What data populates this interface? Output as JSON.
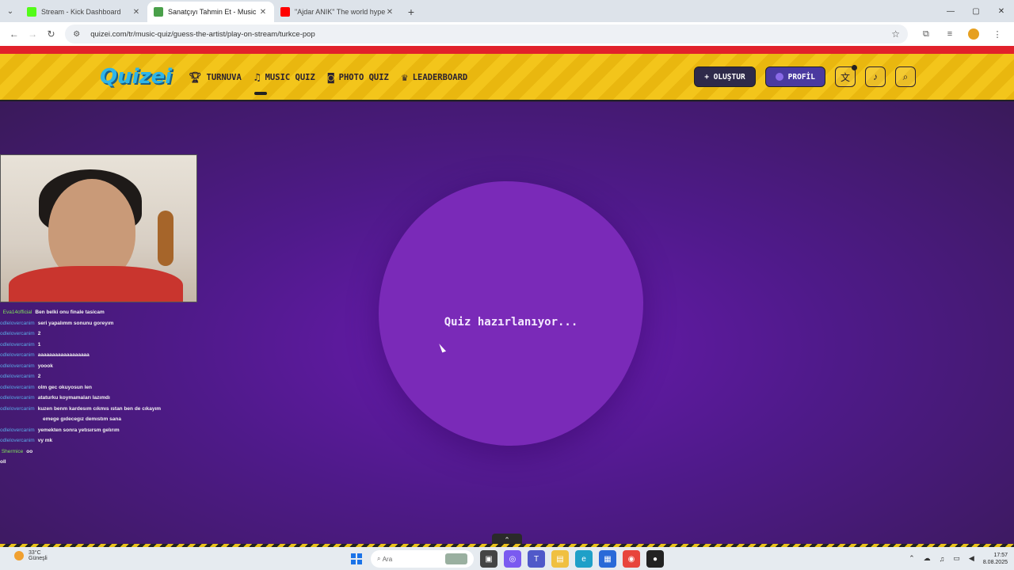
{
  "browser": {
    "tabs": [
      {
        "title": "Stream - Kick Dashboard",
        "favicon_color": "#53fc18",
        "active": false
      },
      {
        "title": "Sanatçıyı Tahmin Et - Music Qu",
        "favicon_color": "#4aa04a",
        "active": true
      },
      {
        "title": "\"Ajdar ANIK\" The world hyper",
        "favicon_color": "#ff0000",
        "active": false
      }
    ],
    "new_tab": "+",
    "url": "quizei.com/tr/music-quiz/guess-the-artist/play-on-stream/turkce-pop"
  },
  "site": {
    "logo": "Quizei",
    "nav": [
      {
        "label": "TURNUVA",
        "icon": "trophy-icon",
        "glyph": "🏆︎"
      },
      {
        "label": "MUSIC QUIZ",
        "icon": "music-note-icon",
        "glyph": "♫",
        "active": true
      },
      {
        "label": "PHOTO QUIZ",
        "icon": "camera-icon",
        "glyph": "◙"
      },
      {
        "label": "LEADERBOARD",
        "icon": "award-icon",
        "glyph": "♛"
      }
    ],
    "create_label": "+ OLUŞTUR",
    "profile_label": "PROFİL",
    "colors": {
      "nav_yellow": "#f3c51b",
      "red_bar": "#e1212b",
      "purple": "#6a1ab0",
      "logo_blue": "#2fb5e8"
    }
  },
  "main": {
    "loading_text": "Quiz hazırlanıyor..."
  },
  "stream_overlay": {
    "chat": [
      {
        "user": "Eva14official",
        "msg": "Ben belki onu finale tasicam",
        "green": true
      },
      {
        "user": "odlelovercanim",
        "msg": "seri yapalımm sonunu goreyım"
      },
      {
        "user": "odlelovercanim",
        "msg": "2"
      },
      {
        "user": "odlelovercanim",
        "msg": "1"
      },
      {
        "user": "odlelovercanim",
        "msg": "aaaaaaaaaaaaaaaaaa"
      },
      {
        "user": "odlelovercanim",
        "msg": "yoook"
      },
      {
        "user": "odlelovercanim",
        "msg": "2"
      },
      {
        "user": "odlelovercanim",
        "msg": "olm gec okuyosun len"
      },
      {
        "user": "odlelovercanim",
        "msg": "ataturku koymamaları lazımdı"
      },
      {
        "user": "odlelovercanim",
        "msg": "kuzen benm kardesım cıkmıs ıstan ben de cıkayım",
        "cont": "emege gıdecegız demıstım sana"
      },
      {
        "user": "odlelovercanim",
        "msg": "yemekten sonra yetısırsm gelırım"
      },
      {
        "user": "odlelovercanim",
        "msg": "vy mk"
      },
      {
        "user": "Shermice",
        "msg": "oo",
        "green": true
      },
      {
        "user": "",
        "msg": "oll"
      }
    ]
  },
  "taskbar": {
    "weather_temp": "33°C",
    "weather_desc": "Güneşli",
    "search_placeholder": "Ara",
    "time": "17:57",
    "date": "8.08.2025"
  }
}
